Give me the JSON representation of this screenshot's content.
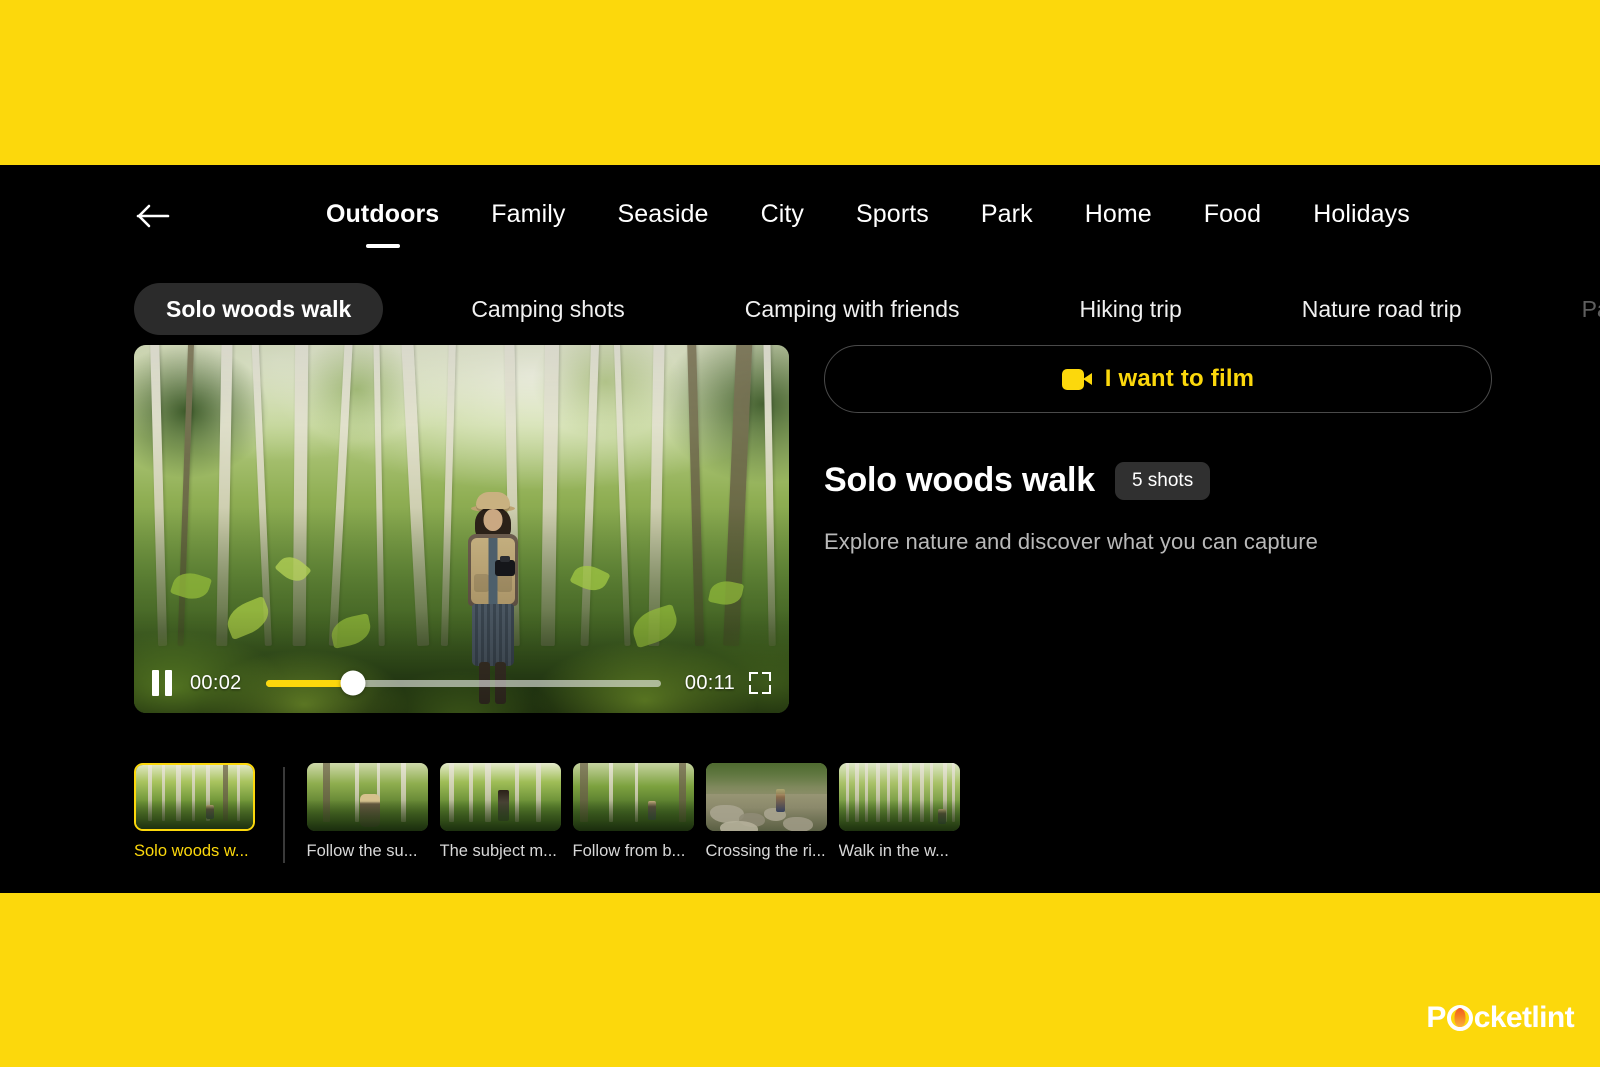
{
  "theme": {
    "page_bg": "#FCD80C",
    "panel_bg": "#000000",
    "accent": "#FCD80C",
    "chip_active_bg": "#2B2B2B",
    "badge_bg": "#303030"
  },
  "nav": {
    "back_icon": "arrow-left-icon",
    "categories": [
      {
        "label": "Outdoors",
        "active": true
      },
      {
        "label": "Family",
        "active": false
      },
      {
        "label": "Seaside",
        "active": false
      },
      {
        "label": "City",
        "active": false
      },
      {
        "label": "Sports",
        "active": false
      },
      {
        "label": "Park",
        "active": false
      },
      {
        "label": "Home",
        "active": false
      },
      {
        "label": "Food",
        "active": false
      },
      {
        "label": "Holidays",
        "active": false
      }
    ]
  },
  "chips": [
    {
      "label": "Solo woods walk",
      "active": true,
      "faded": false
    },
    {
      "label": "Camping shots",
      "active": false,
      "faded": false
    },
    {
      "label": "Camping with friends",
      "active": false,
      "faded": false
    },
    {
      "label": "Hiking trip",
      "active": false,
      "faded": false
    },
    {
      "label": "Nature road trip",
      "active": false,
      "faded": false
    },
    {
      "label": "Partner w",
      "active": false,
      "faded": true
    }
  ],
  "player": {
    "pause_icon": "pause-icon",
    "current_time": "00:02",
    "total_time": "00:11",
    "progress_percent": 22,
    "fullscreen_icon": "fullscreen-icon",
    "scene_alt": "Woman in bucket hat holding a camera standing in a bright forest"
  },
  "info": {
    "film_button": {
      "icon": "video-camera-icon",
      "label": "I want to film"
    },
    "title": "Solo woods walk",
    "shots_badge": "5 shots",
    "description": "Explore nature and discover what you can capture"
  },
  "thumbnails": [
    {
      "label": "Solo woods w...",
      "selected": true,
      "scene": "sc-a"
    },
    {
      "label": "Follow the su...",
      "selected": false,
      "scene": "sc-b"
    },
    {
      "label": "The subject m...",
      "selected": false,
      "scene": "sc-c"
    },
    {
      "label": "Follow from b...",
      "selected": false,
      "scene": "sc-d"
    },
    {
      "label": "Crossing the ri...",
      "selected": false,
      "scene": "sc-e"
    },
    {
      "label": "Walk in the w...",
      "selected": false,
      "scene": "sc-f"
    }
  ],
  "watermark": {
    "prefix": "P",
    "suffix": "cketlint"
  }
}
